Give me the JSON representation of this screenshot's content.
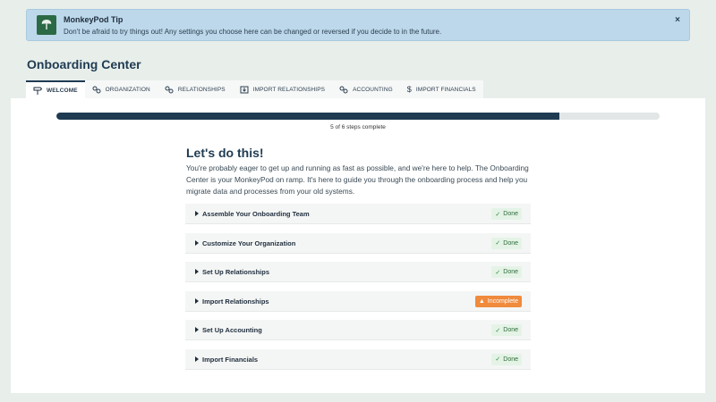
{
  "tip": {
    "title": "MonkeyPod Tip",
    "text": "Don't be afraid to try things out! Any settings you choose here can be changed or reversed if you decide to in the future.",
    "close": "×",
    "logo_icon": "monkeypod-tree-logo",
    "accent": "#2b6a45"
  },
  "page": {
    "title": "Onboarding Center"
  },
  "tabs": [
    {
      "label": "WELCOME",
      "icon": "signpost-icon",
      "active": true
    },
    {
      "label": "ORGANIZATION",
      "icon": "gears-icon"
    },
    {
      "label": "RELATIONSHIPS",
      "icon": "gears-icon"
    },
    {
      "label": "IMPORT RELATIONSHIPS",
      "icon": "import-icon"
    },
    {
      "label": "ACCOUNTING",
      "icon": "gears-icon"
    },
    {
      "label": "IMPORT FINANCIALS",
      "icon": "dollar-icon"
    }
  ],
  "progress": {
    "completed": 5,
    "total": 6,
    "text": "5 of 6 steps complete",
    "color": "#1f3b52"
  },
  "main": {
    "headline": "Let's do this!",
    "intro": "You're probably eager to get up and running as fast as possible, and we're here to help. The Onboarding Center is your MonkeyPod on ramp. It's here to guide you through the onboarding process and help you migrate data and processes from your old systems."
  },
  "steps": [
    {
      "label": "Assemble Your Onboarding Team",
      "status": "Done"
    },
    {
      "label": "Customize Your Organization",
      "status": "Done"
    },
    {
      "label": "Set Up Relationships",
      "status": "Done"
    },
    {
      "label": "Import Relationships",
      "status": "Incomplete"
    },
    {
      "label": "Set Up Accounting",
      "status": "Done"
    },
    {
      "label": "Import Financials",
      "status": "Done"
    }
  ],
  "colors": {
    "done_bg": "#e4f3e6",
    "incomplete_bg": "#f08a3c",
    "banner_bg": "#bcd8ea"
  }
}
